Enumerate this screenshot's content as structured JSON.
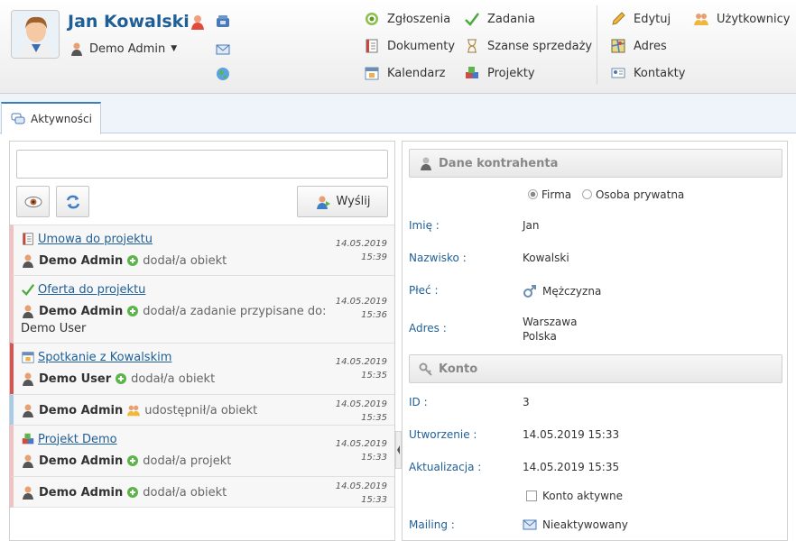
{
  "header": {
    "user_name": "Jan Kowalski",
    "role": "Demo Admin",
    "menu": [
      {
        "label": "Zgłoszenia",
        "icon": "target-icon"
      },
      {
        "label": "Dokumenty",
        "icon": "document-icon"
      },
      {
        "label": "Kalendarz",
        "icon": "calendar-icon"
      },
      {
        "label": "Zadania",
        "icon": "checkmark-icon"
      },
      {
        "label": "Szanse sprzedaży",
        "icon": "hourglass-icon"
      },
      {
        "label": "Projekty",
        "icon": "cubes-icon"
      },
      {
        "label": "Edytuj",
        "icon": "pencil-icon"
      },
      {
        "label": "Adres",
        "icon": "map-icon"
      },
      {
        "label": "Kontakty",
        "icon": "contacts-icon"
      },
      {
        "label": "Użytkownicy",
        "icon": "users-icon"
      }
    ]
  },
  "tabs": {
    "activity": "Aktywności"
  },
  "composer": {
    "placeholder": "",
    "send_label": "Wyślij"
  },
  "feed": [
    {
      "title": "Umowa do projektu",
      "icon": "document-icon",
      "user": "Demo Admin",
      "action": "dodał/a obiekt",
      "date": "14.05.2019",
      "time": "15:39"
    },
    {
      "title": "Oferta do projektu",
      "icon": "checkmark-icon",
      "user": "Demo Admin",
      "action": "dodał/a zadanie przypisane do:",
      "extra": "Demo User",
      "date": "14.05.2019",
      "time": "15:36"
    },
    {
      "title": "Spotkanie z Kowalskim",
      "icon": "calendar-icon",
      "user": "Demo User",
      "action": "dodał/a obiekt",
      "date": "14.05.2019",
      "time": "15:35"
    },
    {
      "title": "",
      "user": "Demo Admin",
      "action": "udostępnił/a obiekt",
      "date": "14.05.2019",
      "time": "15:35"
    },
    {
      "title": "Projekt Demo",
      "icon": "cubes-icon",
      "user": "Demo Admin",
      "action": "dodał/a projekt",
      "date": "14.05.2019",
      "time": "15:33"
    },
    {
      "title": "",
      "user": "Demo Admin",
      "action": "dodał/a obiekt",
      "date": "14.05.2019",
      "time": "15:33"
    }
  ],
  "contractor": {
    "section_title": "Dane kontrahenta",
    "type_options": [
      "Firma",
      "Osoba prywatna"
    ],
    "first_name_label": "Imię :",
    "first_name": "Jan",
    "last_name_label": "Nazwisko :",
    "last_name": "Kowalski",
    "gender_label": "Płeć :",
    "gender": "Mężczyzna",
    "address_label": "Adres :",
    "city": "Warszawa",
    "country": "Polska"
  },
  "account": {
    "section_title": "Konto",
    "id_label": "ID :",
    "id": "3",
    "created_label": "Utworzenie :",
    "created": "14.05.2019 15:33",
    "updated_label": "Aktualizacja :",
    "updated": "14.05.2019 15:35",
    "active_label": "Konto aktywne",
    "mailing_label": "Mailing :",
    "mailing": "Nieaktywowany"
  }
}
